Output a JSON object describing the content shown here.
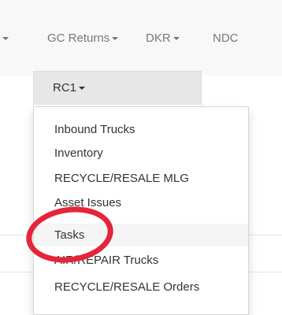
{
  "navbar": {
    "items": [
      {
        "label": "GC Returns"
      },
      {
        "label": "DKR"
      },
      {
        "label": "NDC"
      }
    ]
  },
  "dropdown": {
    "toggle_label": "RC1",
    "items": [
      {
        "label": "Inbound Trucks"
      },
      {
        "label": "Inventory"
      },
      {
        "label": "RECYCLE/RESALE MLG"
      },
      {
        "label": "Asset Issues"
      },
      {
        "label": "Tasks"
      },
      {
        "label": "AIR/REPAIR Trucks"
      },
      {
        "label": "RECYCLE/RESALE Orders"
      }
    ],
    "highlighted_item": "Tasks"
  },
  "annotation": {
    "shape": "ellipse",
    "color": "#e4253a",
    "target": "Tasks"
  }
}
